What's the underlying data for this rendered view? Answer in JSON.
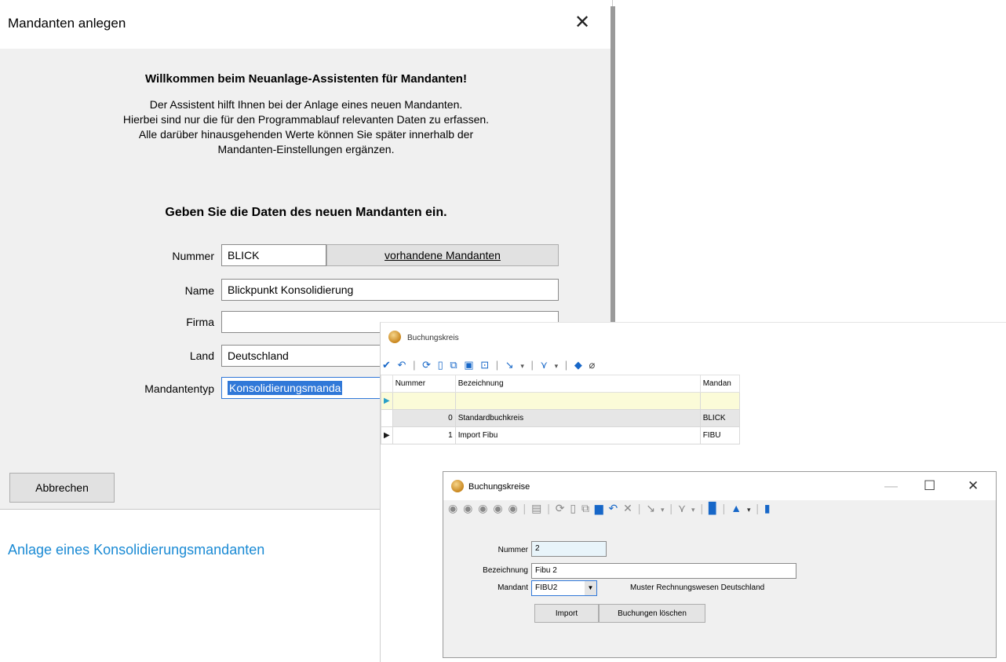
{
  "dialog1": {
    "title": "Mandanten anlegen",
    "close_glyph": "✕",
    "welcome": "Willkommen beim Neuanlage-Assistenten für Mandanten!",
    "intro_lines": [
      "Der Assistent hilft Ihnen bei der Anlage eines neuen Mandanten.",
      "Hierbei sind nur die für den Programmablauf relevanten Daten zu erfassen.",
      "Alle darüber hinausgehenden Werte können Sie später innerhalb der",
      "Mandanten-Einstellungen ergänzen."
    ],
    "subheading": "Geben Sie die Daten des neuen Mandanten ein.",
    "fields": {
      "nummer": {
        "label": "Nummer",
        "value": "BLICK"
      },
      "name": {
        "label": "Name",
        "value": "Blickpunkt Konsolidierung"
      },
      "firma": {
        "label": "Firma",
        "value": ""
      },
      "land": {
        "label": "Land",
        "value": "Deutschland"
      },
      "mandantentyp": {
        "label": "Mandantentyp",
        "value": "Konsolidierungsmanda"
      }
    },
    "existing_button": "vorhandene Mandanten",
    "cancel_button": "Abbrechen"
  },
  "caption": "Anlage eines Konsolidierungsmandanten",
  "window2": {
    "title": "Buchungskreis",
    "columns": [
      "Nummer",
      "Bezeichnung",
      "Mandan"
    ],
    "rows": [
      {
        "nummer": "0",
        "bezeichnung": "Standardbuchkreis",
        "mandant": "BLICK"
      },
      {
        "nummer": "1",
        "bezeichnung": "Import Fibu",
        "mandant": "FIBU"
      }
    ]
  },
  "window3": {
    "title": "Buchungskreise",
    "fields": {
      "nummer": {
        "label": "Nummer",
        "value": "2"
      },
      "bezeichnung": {
        "label": "Bezeichnung",
        "value": "Fibu 2"
      },
      "mandant": {
        "label": "Mandant",
        "value": "FIBU2",
        "description": "Muster Rechnungswesen Deutschland"
      }
    },
    "import_button": "Import",
    "delete_button": "Buchungen löschen"
  },
  "colors": {
    "accent": "#1767c8",
    "caption": "#1a8ad4",
    "selection": "#3078d8",
    "dialog_bg": "#f0f0f0"
  }
}
